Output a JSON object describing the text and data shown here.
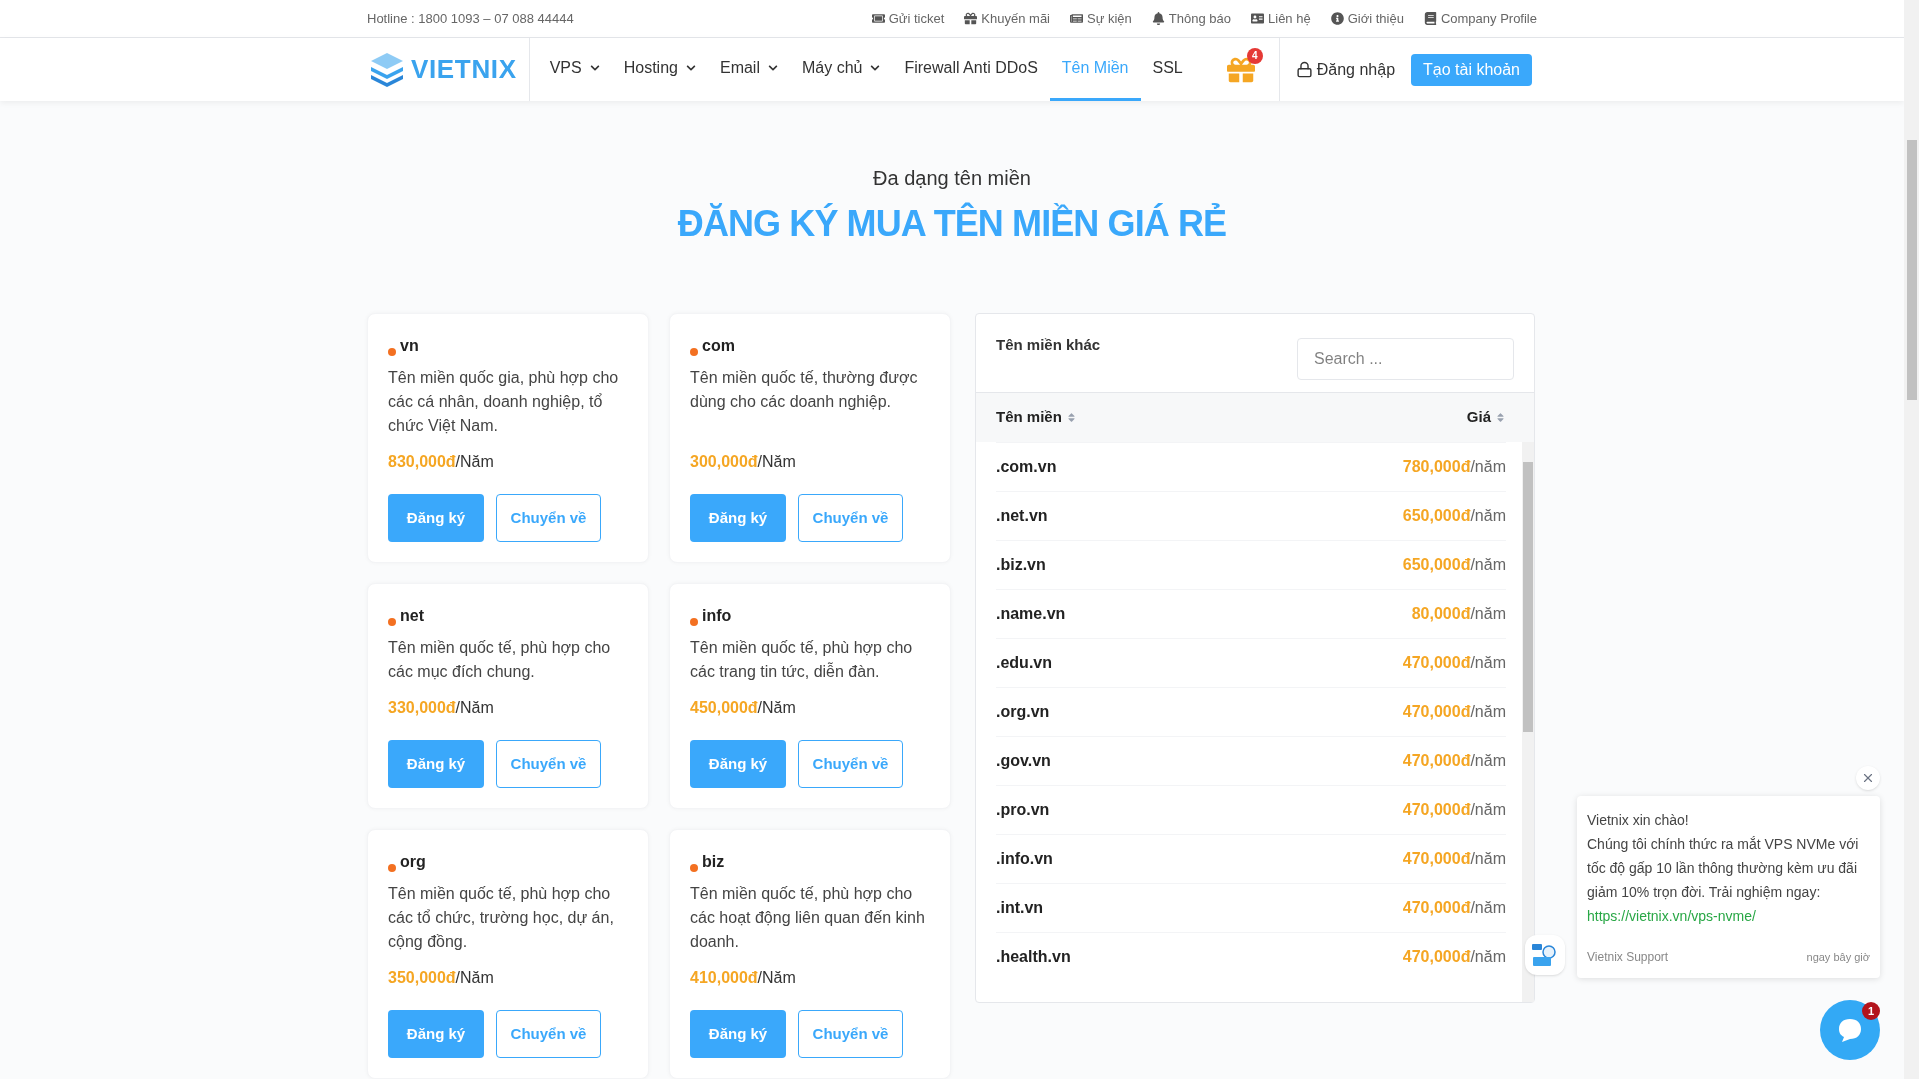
{
  "topbar": {
    "hotline": "Hotline : 1800 1093 – 07 088 44444",
    "links": [
      {
        "label": "Gửi ticket"
      },
      {
        "label": "Khuyến mãi"
      },
      {
        "label": "Sự kiện"
      },
      {
        "label": "Thông báo"
      },
      {
        "label": "Liên hệ"
      },
      {
        "label": "Giới thiệu"
      },
      {
        "label": "Company Profile"
      }
    ]
  },
  "nav": {
    "logo": "VIETNIX",
    "items": [
      {
        "label": "VPS",
        "dropdown": true,
        "selected": false
      },
      {
        "label": "Hosting",
        "dropdown": true,
        "selected": false
      },
      {
        "label": "Email",
        "dropdown": true,
        "selected": false
      },
      {
        "label": "Máy chủ",
        "dropdown": true,
        "selected": false
      },
      {
        "label": "Firewall Anti DDoS",
        "dropdown": false,
        "selected": false
      },
      {
        "label": "Tên Miền",
        "dropdown": false,
        "selected": true
      },
      {
        "label": "SSL",
        "dropdown": false,
        "selected": false
      }
    ],
    "gift_badge": "4",
    "login": "Đăng nhập",
    "signup": "Tạo tài khoản"
  },
  "hero": {
    "subtitle": "Đa dạng tên miền",
    "title": "ĐĂNG KÝ MUA TÊN MIỀN GIÁ RẺ"
  },
  "cards": [
    {
      "name": "vn",
      "description": "Tên miền quốc gia, phù hợp cho các cá nhân, doanh nghiệp, tổ chức Việt Nam.",
      "price": "830,000đ",
      "unit": "/Năm",
      "register": "Đăng ký",
      "transfer": "Chuyển về"
    },
    {
      "name": "com",
      "description": "Tên miền quốc tế, thường được dùng cho các doanh nghiệp.",
      "price": "300,000đ",
      "unit": "/Năm",
      "register": "Đăng ký",
      "transfer": "Chuyển về"
    },
    {
      "name": "net",
      "description": "Tên miền quốc tế, phù hợp cho các mục đích chung.",
      "price": "330,000đ",
      "unit": "/Năm",
      "register": "Đăng ký",
      "transfer": "Chuyển về"
    },
    {
      "name": "info",
      "description": "Tên miền quốc tế, phù hợp cho các trang tin tức, diễn đàn.",
      "price": "450,000đ",
      "unit": "/Năm",
      "register": "Đăng ký",
      "transfer": "Chuyển về"
    },
    {
      "name": "org",
      "description": "Tên miền quốc tế, phù hợp cho các tổ chức, trường học, dự án, cộng đồng.",
      "price": "350,000đ",
      "unit": "/Năm",
      "register": "Đăng ký",
      "transfer": "Chuyển về"
    },
    {
      "name": "biz",
      "description": "Tên miền quốc tế, phù hợp cho các hoạt động liên quan đến kinh doanh.",
      "price": "410,000đ",
      "unit": "/Năm",
      "register": "Đăng ký",
      "transfer": "Chuyển về"
    }
  ],
  "other_domains": {
    "title": "Tên miền khác",
    "search": {
      "placeholder": "Search ..."
    },
    "columns": [
      "Tên miền",
      "Giá"
    ],
    "rows": [
      {
        "domain": ".com.vn",
        "price": "780,000đ",
        "unit": "/năm"
      },
      {
        "domain": ".net.vn",
        "price": "650,000đ",
        "unit": "/năm"
      },
      {
        "domain": ".biz.vn",
        "price": "650,000đ",
        "unit": "/năm"
      },
      {
        "domain": ".name.vn",
        "price": "80,000đ",
        "unit": "/năm"
      },
      {
        "domain": ".edu.vn",
        "price": "470,000đ",
        "unit": "/năm"
      },
      {
        "domain": ".org.vn",
        "price": "470,000đ",
        "unit": "/năm"
      },
      {
        "domain": ".gov.vn",
        "price": "470,000đ",
        "unit": "/năm"
      },
      {
        "domain": ".pro.vn",
        "price": "470,000đ",
        "unit": "/năm"
      },
      {
        "domain": ".info.vn",
        "price": "470,000đ",
        "unit": "/năm"
      },
      {
        "domain": ".int.vn",
        "price": "470,000đ",
        "unit": "/năm"
      },
      {
        "domain": ".health.vn",
        "price": "470,000đ",
        "unit": "/năm"
      }
    ]
  },
  "chat": {
    "greeting": "Vietnix xin chào!",
    "message": "Chúng tôi chính thức ra mắt VPS NVMe với tốc độ gấp 10 lần thông thường kèm ưu đãi giảm 10% trọn đời. Trải nghiệm ngay:",
    "link": "https://vietnix.vn/vps-nvme/",
    "sender": "Vietnix Support",
    "time": "ngay bây giờ",
    "badge": "1"
  }
}
